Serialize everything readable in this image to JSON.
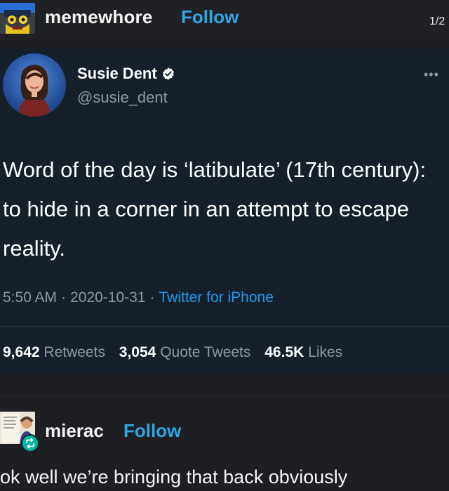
{
  "post": {
    "username": "memewhore",
    "follow_label": "Follow",
    "page_indicator": "1/2"
  },
  "tweet": {
    "display_name": "Susie Dent",
    "handle": "@susie_dent",
    "text": "Word of the day is ‘latibulate’ (17th century): to hide in a corner in an attempt to escape reality.",
    "time": "5:50 AM",
    "date": "2020-10-31",
    "source": "Twitter for iPhone",
    "stats": {
      "retweets_value": "9,642",
      "retweets_label": "Retweets",
      "quotes_value": "3,054",
      "quotes_label": "Quote Tweets",
      "likes_value": "46.5K",
      "likes_label": "Likes"
    },
    "colors": {
      "background": "#15202b",
      "link": "#1d9bf0",
      "secondary_text": "#8b98a5"
    }
  },
  "reblog": {
    "username": "mierac",
    "follow_label": "Follow",
    "text": "ok well we’re bringing that back obviously"
  },
  "icons": [
    "verified-icon",
    "more-options-icon",
    "reblog-icon"
  ],
  "colors": {
    "page_background": "#1d1f22",
    "follow_blue": "#2da6e2",
    "reblog_badge": "#00b8a3"
  }
}
